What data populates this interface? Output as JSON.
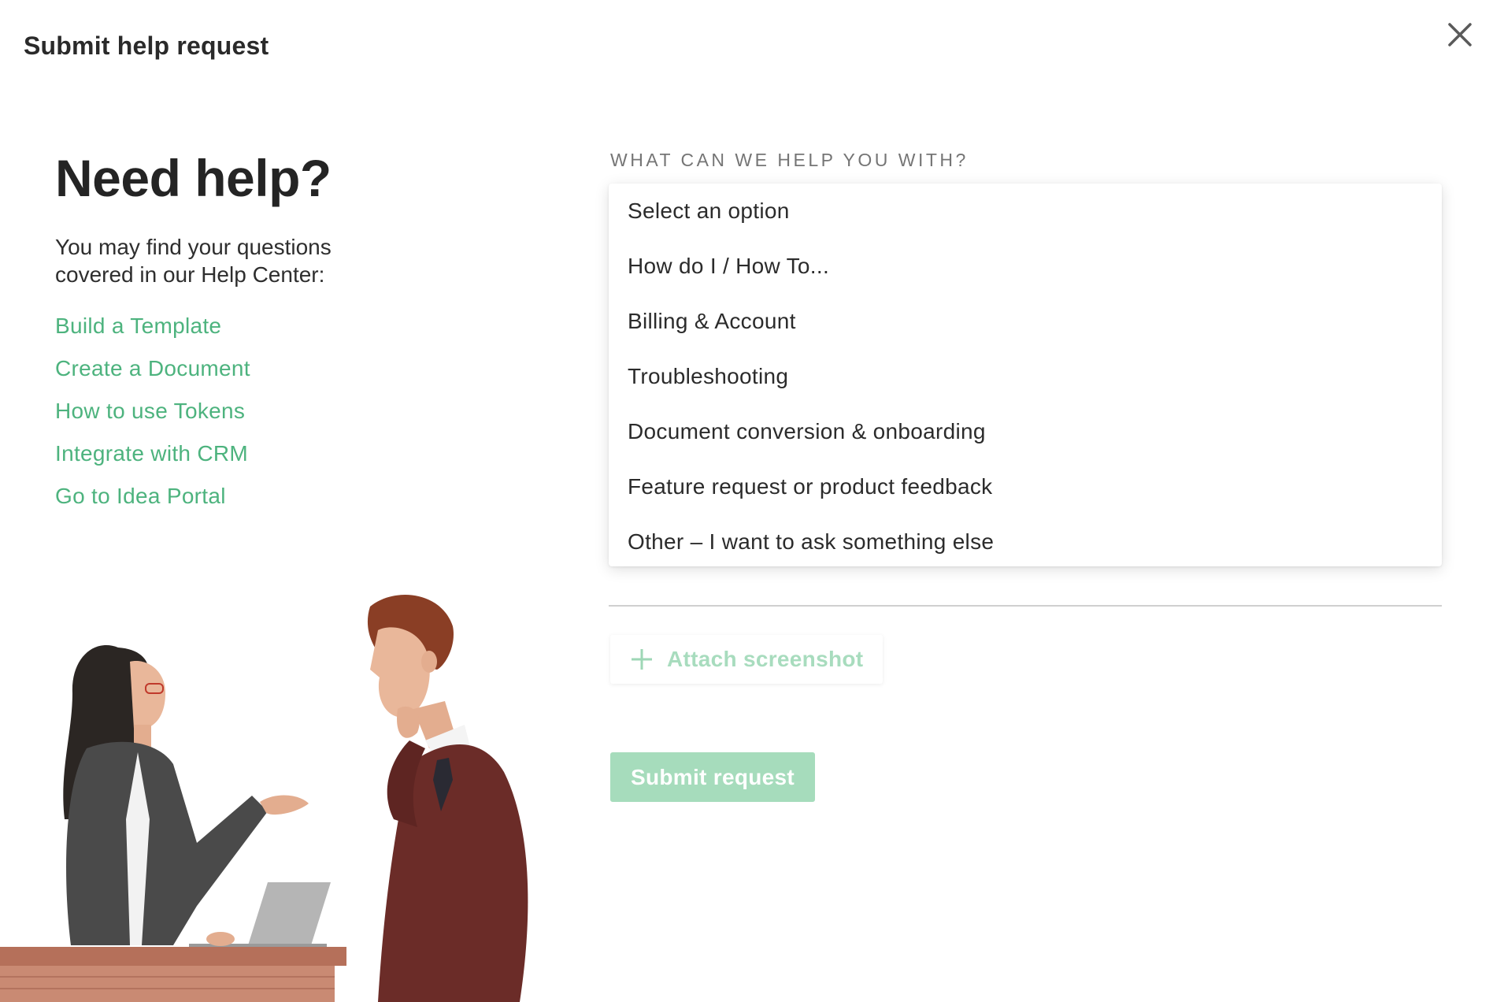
{
  "modal": {
    "title": "Submit help request",
    "close_icon": "close-icon"
  },
  "left": {
    "heading": "Need help?",
    "intro": "You may find your questions covered in our Help Center:",
    "links": [
      {
        "label": "Build a Template"
      },
      {
        "label": "Create a Document"
      },
      {
        "label": "How to use Tokens"
      },
      {
        "label": "Integrate with CRM"
      },
      {
        "label": "Go to Idea Portal"
      }
    ],
    "link_color": "#4db37e"
  },
  "form": {
    "topic_label": "WHAT CAN WE HELP YOU WITH?",
    "topic_options": [
      "Select an option",
      "How do I / How To...",
      "Billing & Account",
      "Troubleshooting",
      "Document conversion & onboarding",
      "Feature request or product feedback",
      "Other – I want to ask something else"
    ],
    "topic_dropdown_open": true,
    "attach_label": "Attach screenshot",
    "attach_icon": "plus-icon",
    "submit_label": "Submit request",
    "submit_color": "#a6dcbc"
  },
  "illustration": "two-people-at-desk-illustration"
}
